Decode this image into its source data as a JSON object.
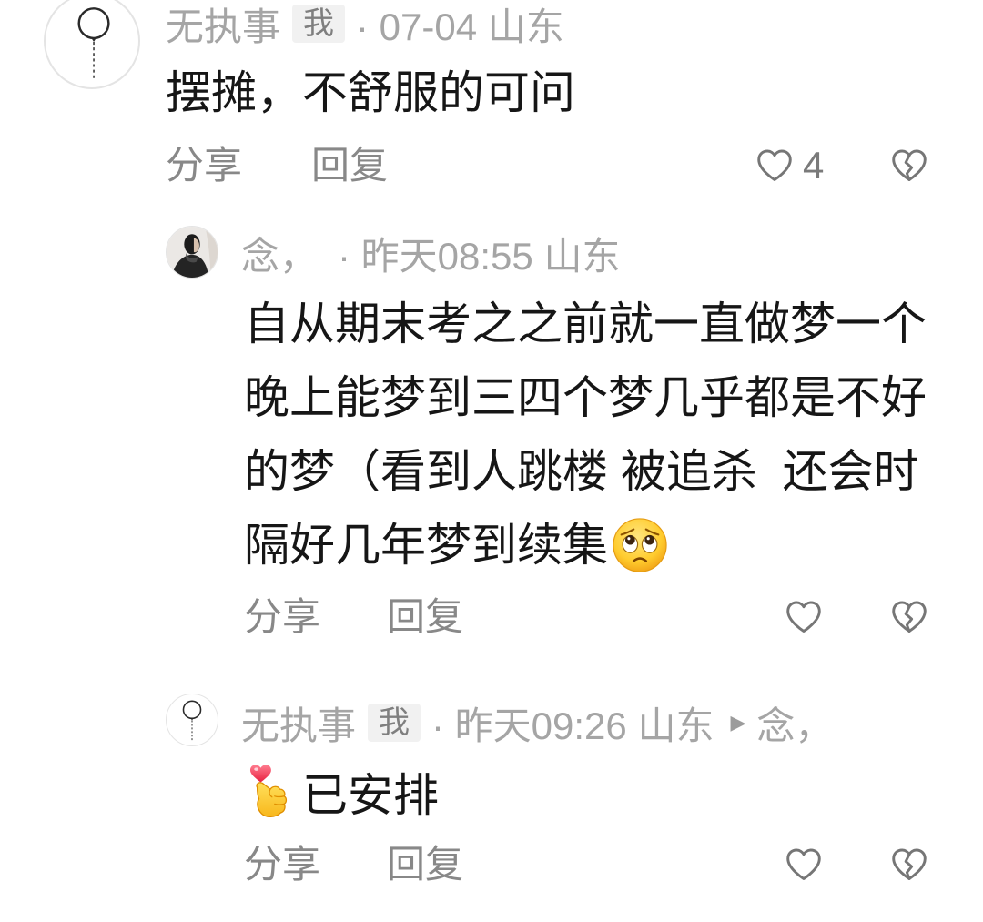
{
  "comment": {
    "avatar_icon": "balloon-icon",
    "username": "无执事",
    "badge": "我",
    "meta": "· 07-04 山东",
    "text": "摆摊，不舒服的可问",
    "share_label": "分享",
    "reply_label": "回复",
    "like_icon": "heart-outline-icon",
    "like_count": "4",
    "dislike_icon": "broken-heart-icon"
  },
  "replies": [
    {
      "avatar": "photo-avatar",
      "username": "念，",
      "meta": "· 昨天08:55 山东",
      "text": "自从期末考之之前就一直做梦一个晚上能梦到三四个梦几乎都是不好的梦（看到人跳楼 被追杀  还会时隔好几年梦到续集",
      "trailing_emoji": "frowning-face-emoji",
      "share_label": "分享",
      "reply_label": "回复",
      "like_icon": "heart-outline-icon",
      "dislike_icon": "broken-heart-icon"
    },
    {
      "avatar_icon": "balloon-icon",
      "username": "无执事",
      "badge": "我",
      "meta": "· 昨天09:26 山东",
      "reply_to_icon": "▶",
      "reply_to": "念，",
      "leading_emoji": "finger-heart-emoji",
      "text": "已安排",
      "share_label": "分享",
      "reply_label": "回复",
      "like_icon": "heart-outline-icon",
      "dislike_icon": "broken-heart-icon"
    }
  ],
  "colors": {
    "text_primary": "#161616",
    "text_meta": "#a5a5a5",
    "action_label": "#888888",
    "icon_stroke": "#767676",
    "badge_bg": "#f1f1f1",
    "badge_text": "#7f7f7f"
  }
}
